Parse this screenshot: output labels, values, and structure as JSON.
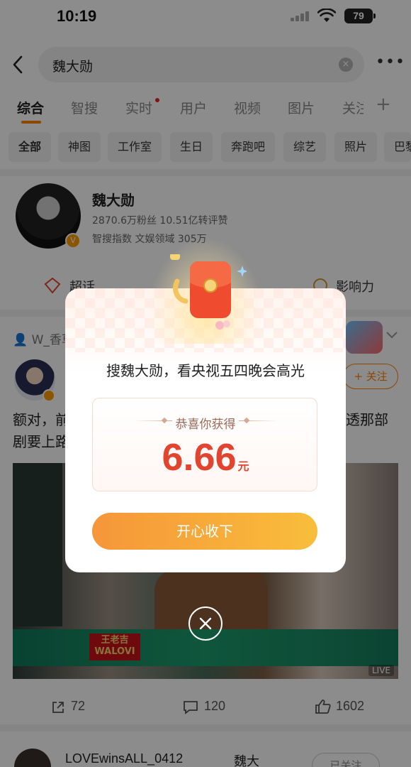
{
  "status_bar": {
    "time": "10:19",
    "battery": "79"
  },
  "search": {
    "query": "魏大勋",
    "clear_symbol": "×",
    "more_symbol": "•••"
  },
  "tabs": [
    {
      "label": "综合"
    },
    {
      "label": "智搜"
    },
    {
      "label": "实时"
    },
    {
      "label": "用户"
    },
    {
      "label": "视频"
    },
    {
      "label": "图片"
    },
    {
      "label": "关注"
    }
  ],
  "tab_add_symbol": "+",
  "chips": [
    "全部",
    "神图",
    "工作室",
    "生日",
    "奔跑吧",
    "综艺",
    "照片",
    "巴黎"
  ],
  "profile": {
    "name": "魏大勋",
    "stats": "2870.6万粉丝   10.51亿转评赞",
    "index": "智搜指数 文娱领域 305万",
    "actions": [
      "超话",
      "影响力"
    ]
  },
  "post": {
    "source": "W_香草",
    "follow_label": "+ 关注",
    "text_line1": "额对，前",
    "text_line1_end": "透那部",
    "text_line2": "剧要上路",
    "image_brand": "王老吉 WALOVI",
    "live_label": "LIVE",
    "shares": "72",
    "comments": "120",
    "likes": "1602"
  },
  "post2": {
    "username": "LOVEwinsALL_0412",
    "extra": "魏大",
    "follow_label": "已关注"
  },
  "modal": {
    "title": "搜魏大勋，看央视五四晚会高光",
    "prize_label": "恭喜你获得",
    "prize_amount": "6.66",
    "prize_unit": "元",
    "cta_label": "开心收下"
  },
  "colors": {
    "accent": "#ff8200",
    "prize_red": "#e2452f",
    "cta_start": "#f6963a",
    "cta_end": "#f8be3b"
  }
}
